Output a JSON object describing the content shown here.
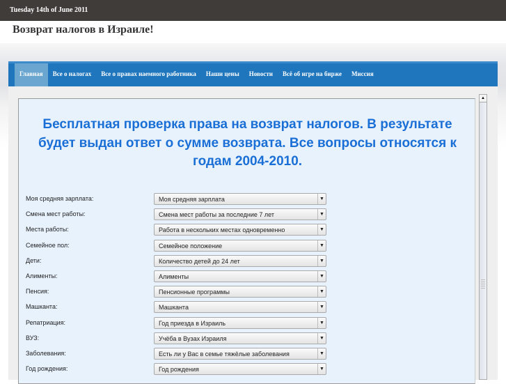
{
  "date": "Tuesday 14th of June 2011",
  "site_title": "Возврат налогов в Израиле!",
  "nav": [
    "Главная",
    "Все о налогах",
    "Все о правах наемного работника",
    "Наши цены",
    "Новости",
    "Всё об игре на бирже",
    "Миссия"
  ],
  "headline": "Бесплатная проверка права на возврат налогов. В результате будет выдан ответ о сумме возврата. Все вопросы относятся к годам 2004-2010.",
  "form": [
    {
      "label": "Моя средняя зарплата:",
      "value": "Моя средняя зарплата"
    },
    {
      "label": "Смена мест работы:",
      "value": "Смена мест работы за последние 7 лет"
    },
    {
      "label": "Места работы:",
      "value": "Работа в нескольких местах одновременно"
    },
    {
      "label": "Семейное пол:",
      "value": "Семейное положение"
    },
    {
      "label": "Дети:",
      "value": "Количество детей до 24 лет"
    },
    {
      "label": "Алименты:",
      "value": "Алименты"
    },
    {
      "label": "Пенсия:",
      "value": "Пенсионные программы"
    },
    {
      "label": "Машканта:",
      "value": "Машканта"
    },
    {
      "label": "Репатриация:",
      "value": "Год приезда в Израиль"
    },
    {
      "label": "ВУЗ:",
      "value": "Учёба в Вузах Израиля"
    },
    {
      "label": "Заболевания:",
      "value": "Есть ли у Вас в семье тяжёлые заболевания"
    },
    {
      "label": "Год рождения:",
      "value": "Год рождения"
    }
  ]
}
